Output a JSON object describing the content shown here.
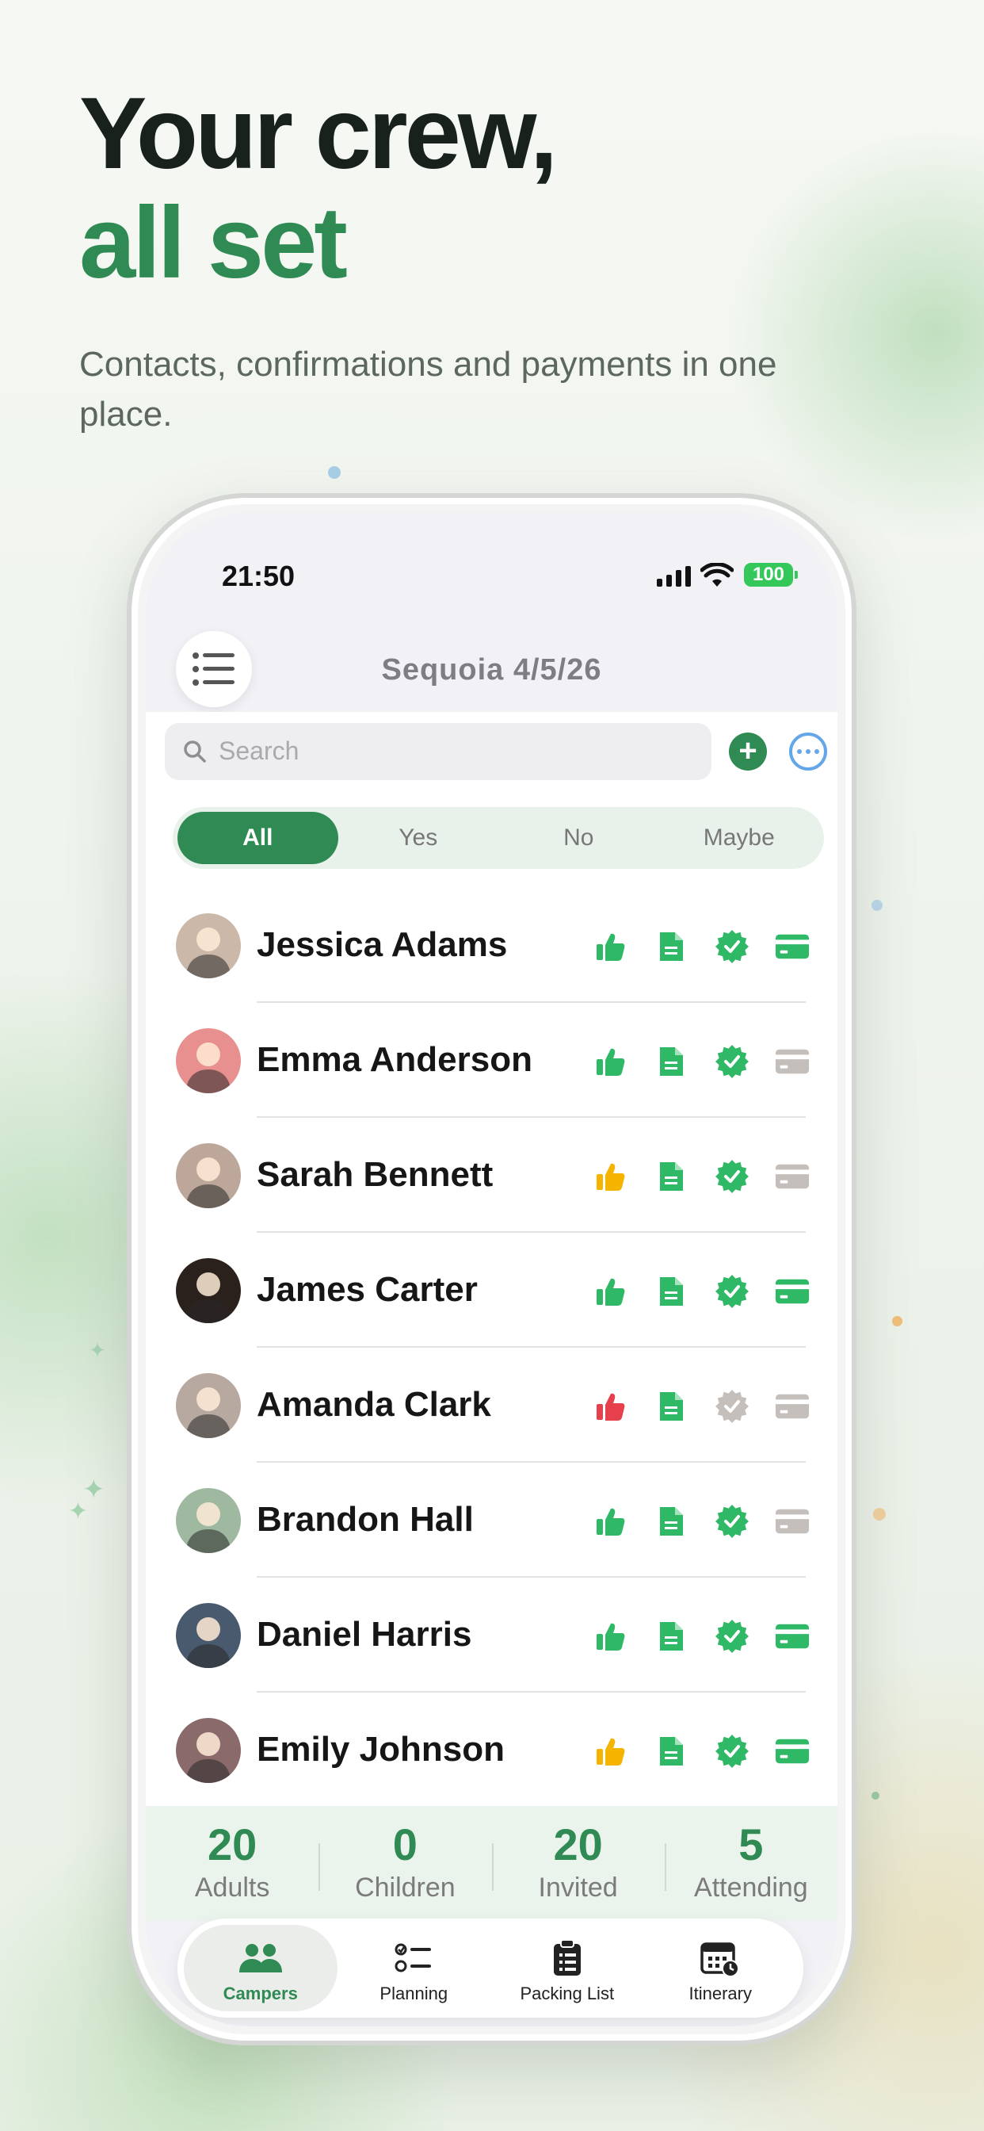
{
  "headline": {
    "line1": "Your crew,",
    "line2": "all set",
    "subtitle": "Contacts, confirmations and payments in one place."
  },
  "status_bar": {
    "time": "21:50",
    "battery": "100"
  },
  "nav": {
    "title": "Sequoia 4/5/26",
    "menu_icon": "list-icon"
  },
  "search": {
    "placeholder": "Search"
  },
  "actions": {
    "add_icon": "plus-icon",
    "more_icon": "ellipsis-icon"
  },
  "filter": {
    "options": [
      "All",
      "Yes",
      "No",
      "Maybe"
    ],
    "selected": "All"
  },
  "colors": {
    "brand_green": "#2f8a53",
    "icon_green": "#2fb865",
    "icon_yellow": "#f5b400",
    "icon_red": "#e5404b",
    "icon_gray": "#c5bfbc"
  },
  "campers": [
    {
      "name": "Jessica Adams",
      "rsvp": "yes",
      "document": "complete",
      "verified": true,
      "paid": true,
      "avatar_color": "#cbb8a9"
    },
    {
      "name": "Emma Anderson",
      "rsvp": "yes",
      "document": "complete",
      "verified": true,
      "paid": false,
      "avatar_color": "#e88f8f"
    },
    {
      "name": "Sarah Bennett",
      "rsvp": "maybe",
      "document": "complete",
      "verified": true,
      "paid": false,
      "avatar_color": "#bda79a"
    },
    {
      "name": "James Carter",
      "rsvp": "yes",
      "document": "complete",
      "verified": true,
      "paid": true,
      "avatar_color": "#2a211d"
    },
    {
      "name": "Amanda Clark",
      "rsvp": "no",
      "document": "complete",
      "verified": false,
      "paid": false,
      "avatar_color": "#b7a8a0"
    },
    {
      "name": "Brandon Hall",
      "rsvp": "yes",
      "document": "complete",
      "verified": true,
      "paid": false,
      "avatar_color": "#9fb8a0"
    },
    {
      "name": "Daniel Harris",
      "rsvp": "yes",
      "document": "complete",
      "verified": true,
      "paid": true,
      "avatar_color": "#4a5a6e"
    },
    {
      "name": "Emily Johnson",
      "rsvp": "maybe",
      "document": "complete",
      "verified": true,
      "paid": true,
      "avatar_color": "#8a6a6a"
    }
  ],
  "stats": [
    {
      "value": "20",
      "label": "Adults"
    },
    {
      "value": "0",
      "label": "Children"
    },
    {
      "value": "20",
      "label": "Invited"
    },
    {
      "value": "5",
      "label": "Attending"
    }
  ],
  "tabs": [
    {
      "label": "Campers",
      "icon": "people-icon",
      "active": true
    },
    {
      "label": "Planning",
      "icon": "checklist-icon",
      "active": false
    },
    {
      "label": "Packing List",
      "icon": "clipboard-icon",
      "active": false
    },
    {
      "label": "Itinerary",
      "icon": "calendar-clock-icon",
      "active": false
    }
  ]
}
